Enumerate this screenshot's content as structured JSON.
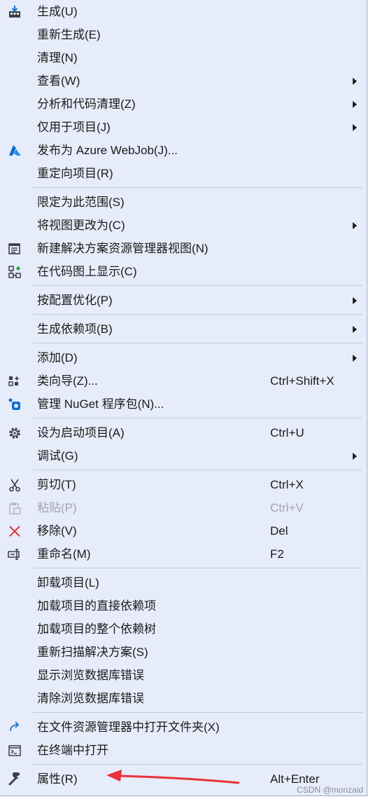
{
  "menu": {
    "items": [
      {
        "type": "item",
        "label": "生成(U)",
        "icon": "build-icon"
      },
      {
        "type": "item",
        "label": "重新生成(E)"
      },
      {
        "type": "item",
        "label": "清理(N)"
      },
      {
        "type": "item",
        "label": "查看(W)",
        "submenu": true
      },
      {
        "type": "item",
        "label": "分析和代码清理(Z)",
        "submenu": true
      },
      {
        "type": "item",
        "label": "仅用于项目(J)",
        "submenu": true
      },
      {
        "type": "item",
        "label": "发布为 Azure WebJob(J)...",
        "icon": "azure-icon"
      },
      {
        "type": "item",
        "label": "重定向项目(R)"
      },
      {
        "type": "separator"
      },
      {
        "type": "item",
        "label": "限定为此范围(S)"
      },
      {
        "type": "item",
        "label": "将视图更改为(C)",
        "submenu": true
      },
      {
        "type": "item",
        "label": "新建解决方案资源管理器视图(N)",
        "icon": "new-view-icon"
      },
      {
        "type": "item",
        "label": "在代码图上显示(C)",
        "icon": "code-map-icon"
      },
      {
        "type": "separator"
      },
      {
        "type": "item",
        "label": "按配置优化(P)",
        "submenu": true
      },
      {
        "type": "separator"
      },
      {
        "type": "item",
        "label": "生成依赖项(B)",
        "submenu": true
      },
      {
        "type": "separator"
      },
      {
        "type": "item",
        "label": "添加(D)",
        "submenu": true
      },
      {
        "type": "item",
        "label": "类向导(Z)...",
        "shortcut": "Ctrl+Shift+X",
        "icon": "class-wizard-icon"
      },
      {
        "type": "item",
        "label": "管理 NuGet 程序包(N)...",
        "icon": "nuget-icon"
      },
      {
        "type": "separator"
      },
      {
        "type": "item",
        "label": "设为启动项目(A)",
        "shortcut": "Ctrl+U",
        "icon": "gear-icon"
      },
      {
        "type": "item",
        "label": "调试(G)",
        "submenu": true
      },
      {
        "type": "separator"
      },
      {
        "type": "item",
        "label": "剪切(T)",
        "shortcut": "Ctrl+X",
        "icon": "scissors-icon"
      },
      {
        "type": "item",
        "label": "粘贴(P)",
        "shortcut": "Ctrl+V",
        "icon": "paste-icon",
        "disabled": true
      },
      {
        "type": "item",
        "label": "移除(V)",
        "shortcut": "Del",
        "icon": "remove-x-icon"
      },
      {
        "type": "item",
        "label": "重命名(M)",
        "shortcut": "F2",
        "icon": "rename-icon"
      },
      {
        "type": "separator"
      },
      {
        "type": "item",
        "label": "卸载项目(L)"
      },
      {
        "type": "item",
        "label": "加载项目的直接依赖项"
      },
      {
        "type": "item",
        "label": "加载项目的整个依赖树"
      },
      {
        "type": "item",
        "label": "重新扫描解决方案(S)"
      },
      {
        "type": "item",
        "label": "显示浏览数据库错误"
      },
      {
        "type": "item",
        "label": "清除浏览数据库错误"
      },
      {
        "type": "separator"
      },
      {
        "type": "item",
        "label": "在文件资源管理器中打开文件夹(X)",
        "icon": "open-folder-icon"
      },
      {
        "type": "item",
        "label": "在终端中打开",
        "icon": "terminal-icon"
      },
      {
        "type": "separator"
      },
      {
        "type": "item",
        "label": "属性(R)",
        "shortcut": "Alt+Enter",
        "icon": "wrench-icon"
      }
    ]
  },
  "watermark": "CSDN @monzaid",
  "colors": {
    "menu_bg": "#e6ecf9",
    "accent_blue": "#1a73c9",
    "remove_red": "#d83b3b",
    "arrow_red": "#e8333a"
  }
}
